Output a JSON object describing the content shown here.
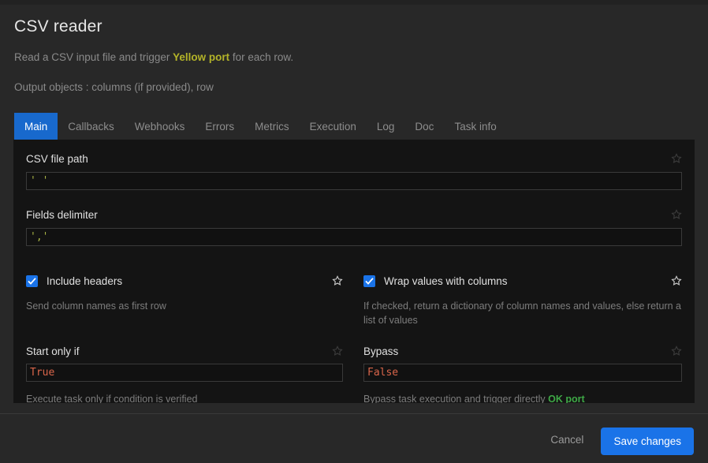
{
  "background_strip": {
    "text": " "
  },
  "dialog": {
    "title": "CSV reader",
    "description_prefix": "Read a CSV input file and trigger ",
    "description_highlight": "Yellow port",
    "description_suffix": " for each row.",
    "description_2": "Output objects : columns (if provided), row"
  },
  "tabs": [
    {
      "label": "Main"
    },
    {
      "label": "Callbacks"
    },
    {
      "label": "Webhooks"
    },
    {
      "label": "Errors"
    },
    {
      "label": "Metrics"
    },
    {
      "label": "Execution"
    },
    {
      "label": "Log"
    },
    {
      "label": "Doc"
    },
    {
      "label": "Task info"
    }
  ],
  "fields": {
    "csv_file_path": {
      "label": "CSV file path",
      "value": "' '",
      "placeholder": ""
    },
    "fields_delimiter": {
      "label": "Fields delimiter",
      "value": "','",
      "placeholder": ""
    },
    "include_headers": {
      "label": "Include headers",
      "checked": true,
      "help": "Send column names as first row"
    },
    "wrap_values": {
      "label": "Wrap values with columns",
      "checked": true,
      "help": "If checked, return a dictionary of column names and values, else return a list of values"
    },
    "start_only_if": {
      "label": "Start only if",
      "value": "True",
      "help": "Execute task only if condition is verified"
    },
    "bypass": {
      "label": "Bypass",
      "value": "False",
      "help_prefix": "Bypass task execution and trigger directly ",
      "help_highlight": "OK port"
    }
  },
  "footer": {
    "cancel_label": "Cancel",
    "save_label": "Save changes"
  },
  "colors": {
    "accent_blue": "#1a73e8",
    "tab_active_blue": "#1869cd",
    "yellow_port": "#b3b328",
    "ok_port_green": "#3ea846",
    "code_string": "#a9b545",
    "code_keyword": "#d9654a",
    "panel_bg": "#141414",
    "dialog_bg": "#282828"
  }
}
